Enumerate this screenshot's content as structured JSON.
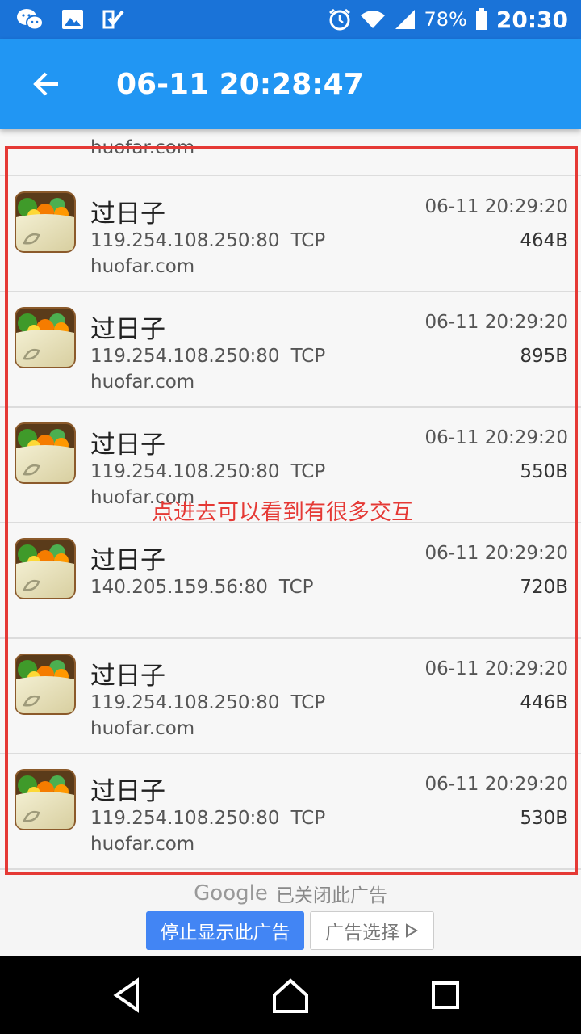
{
  "status_bar": {
    "battery": "78%",
    "time": "20:30",
    "left_icons": [
      "wechat-icon",
      "gallery-icon",
      "check-task-icon"
    ],
    "right_icons": [
      "alarm-icon",
      "wifi-icon",
      "signal-icon",
      "battery-icon"
    ]
  },
  "app_bar": {
    "title": "06-11 20:28:47",
    "back_icon": "arrow-back-icon",
    "color": "#2196f3"
  },
  "connections": [
    {
      "name": "过日子",
      "ip": "119.254.108.250:80",
      "protocol": "TCP",
      "domain": "huofar.com",
      "timestamp": "06-11 20:29:20",
      "size": "464B"
    },
    {
      "name": "过日子",
      "ip": "119.254.108.250:80",
      "protocol": "TCP",
      "domain": "huofar.com",
      "timestamp": "06-11 20:29:20",
      "size": "895B"
    },
    {
      "name": "过日子",
      "ip": "119.254.108.250:80",
      "protocol": "TCP",
      "domain": "huofar.com",
      "timestamp": "06-11 20:29:20",
      "size": "550B"
    },
    {
      "name": "过日子",
      "ip": "140.205.159.56:80",
      "protocol": "TCP",
      "domain": "",
      "timestamp": "06-11 20:29:20",
      "size": "720B"
    },
    {
      "name": "过日子",
      "ip": "119.254.108.250:80",
      "protocol": "TCP",
      "domain": "huofar.com",
      "timestamp": "06-11 20:29:20",
      "size": "446B"
    },
    {
      "name": "过日子",
      "ip": "119.254.108.250:80",
      "protocol": "TCP",
      "domain": "huofar.com",
      "timestamp": "06-11 20:29:20",
      "size": "530B"
    }
  ],
  "partial_row": {
    "domain": "huofar.com"
  },
  "annotation": {
    "text": "点进去可以看到有很多交互",
    "color": "#e53935"
  },
  "ad": {
    "brand": "Google",
    "closed_text": "已关闭此广告",
    "stop_button": "停止显示此广告",
    "choice_button": "广告选择"
  },
  "nav_icons": [
    "back-triangle-icon",
    "home-icon",
    "recents-icon"
  ]
}
